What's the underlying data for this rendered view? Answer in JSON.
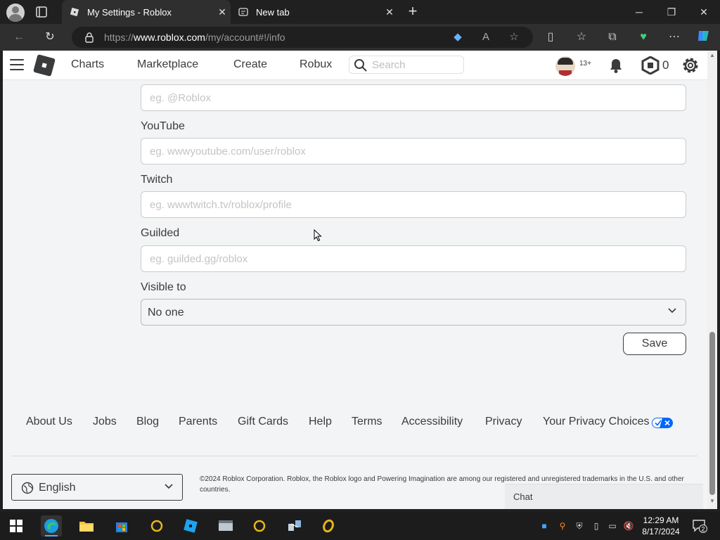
{
  "browser": {
    "tabs": [
      {
        "title": "My Settings - Roblox",
        "active": true
      },
      {
        "title": "New tab",
        "active": false
      }
    ],
    "url_prefix": "https://",
    "url_domain": "www.roblox.com",
    "url_path": "/my/account#!/info"
  },
  "nav": {
    "links": [
      "Charts",
      "Marketplace",
      "Create",
      "Robux"
    ],
    "search_placeholder": "Search",
    "age_badge": "13+",
    "robux_count": "0"
  },
  "form": {
    "first_placeholder": "eg. @Roblox",
    "youtube": {
      "label": "YouTube",
      "placeholder": "eg. wwwyoutube.com/user/roblox"
    },
    "twitch": {
      "label": "Twitch",
      "placeholder": "eg. wwwtwitch.tv/roblox/profile"
    },
    "guilded": {
      "label": "Guilded",
      "placeholder": "eg. guilded.gg/roblox"
    },
    "visible_to": {
      "label": "Visible to",
      "value": "No one"
    },
    "save_label": "Save"
  },
  "footer": {
    "links": [
      "About Us",
      "Jobs",
      "Blog",
      "Parents",
      "Gift Cards",
      "Help",
      "Terms",
      "Accessibility",
      "Privacy",
      "Your Privacy Choices"
    ],
    "language": "English",
    "copyright": "©2024 Roblox Corporation. Roblox, the Roblox logo and Powering Imagination are among our registered and unregistered trademarks in the U.S. and other countries."
  },
  "chat": {
    "label": "Chat"
  },
  "taskbar": {
    "time": "12:29 AM",
    "date": "8/17/2024",
    "notification_count": "2"
  },
  "colors": {
    "page_bg": "#f2f4f5",
    "text": "#393b3d",
    "browser_chrome": "#202020",
    "accent": "#0066ff"
  }
}
